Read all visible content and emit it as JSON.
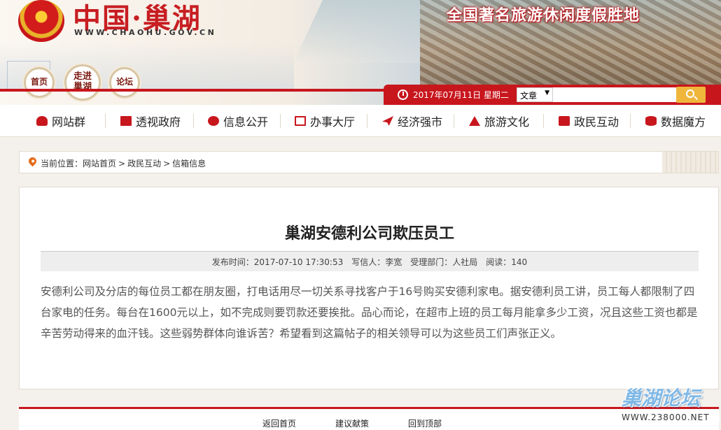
{
  "header": {
    "site_name_cn": "中国·巢湖",
    "site_url": "WWW.CHAOHU.GOV.CN",
    "slogan": "全国著名旅游休闲度假胜地",
    "round_buttons": {
      "home": "首页",
      "intro": "走进巢湖",
      "forum": "论坛"
    },
    "date": "2017年07月11日  星期二",
    "search": {
      "select_value": "文章",
      "arrow": "▼",
      "placeholder": ""
    }
  },
  "nav": {
    "items": [
      {
        "label": "网站群",
        "icon": "people-icon"
      },
      {
        "label": "透视政府",
        "icon": "book-icon"
      },
      {
        "label": "信息公开",
        "icon": "pie-chart-icon"
      },
      {
        "label": "办事大厅",
        "icon": "mail-icon"
      },
      {
        "label": "经济强市",
        "icon": "paper-plane-icon"
      },
      {
        "label": "旅游文化",
        "icon": "mountain-icon"
      },
      {
        "label": "政民互动",
        "icon": "chat-icon"
      },
      {
        "label": "数据魔方",
        "icon": "database-icon"
      }
    ]
  },
  "breadcrumb": {
    "prefix": "当前位置：",
    "items": [
      "网站首页",
      "政民互动",
      "信箱信息"
    ],
    "separator": ">"
  },
  "article": {
    "title": "巢湖安德利公司欺压员工",
    "meta": {
      "publish_time": "发布时间：2017-07-10 17:30:53",
      "author": "写信人：李宽",
      "department": "受理部门：人社局",
      "reads": "阅读：140"
    },
    "body": "安德利公司及分店的每位员工都在朋友圈，打电话用尽一切关系寻找客户于16号购买安德利家电。据安德利员工讲，员工每人都限制了四台家电的任务。每台在1600元以上，如不完成则要罚款还要挨批。品心而论，在超市上班的员工每月能拿多少工资，况且这些工资也都是辛苦劳动得来的血汗钱。这些弱势群体向谁诉苦？希望看到这篇帖子的相关领导可以为这些员工们声张正义。"
  },
  "footer": {
    "links": [
      "返回首页",
      "建议献策",
      "回到顶部"
    ]
  },
  "watermark": {
    "logo": "巢湖论坛",
    "url": "WWW.238000.NET"
  },
  "colors": {
    "brand_red": "#c8161d",
    "search_button": "#f0b63c",
    "page_bg": "#f4f1ec"
  }
}
